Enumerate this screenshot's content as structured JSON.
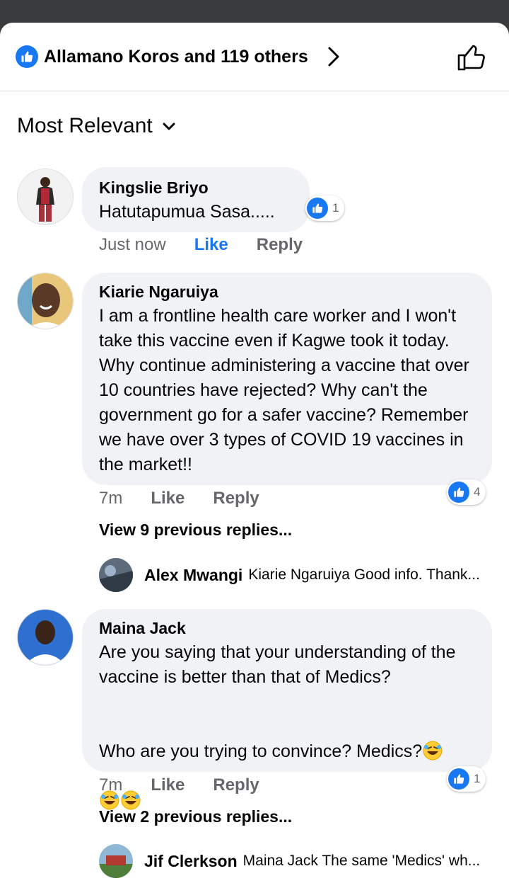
{
  "reactions": {
    "summary": "Allamano Koros and 119 others",
    "icon": "like-badge-icon"
  },
  "sort": {
    "label": "Most Relevant"
  },
  "comments": [
    {
      "author": "Kingslie Briyo",
      "text": "Hatutapumua Sasa.....",
      "time": "Just now",
      "like_label": "Like",
      "reply_label": "Reply",
      "like_count": "1",
      "liked": true
    },
    {
      "author": "Kiarie Ngaruiya",
      "text": "I am a frontline health care worker and I won't take this vaccine even if Kagwe took it today. Why continue administering a vaccine that over 10 countries have rejected? Why can't the government go for a safer vaccine? Remember we have over 3 types of COVID 19 vaccines in the market!!",
      "time": "7m",
      "like_label": "Like",
      "reply_label": "Reply",
      "like_count": "4",
      "view_replies": "View 9 previous replies...",
      "latest_reply": {
        "author": "Alex Mwangi",
        "text": "Kiarie Ngaruiya Good info. Thank..."
      }
    },
    {
      "author": "Maina Jack",
      "text_line1": "Are you saying that your understanding of the vaccine is better than that of Medics?",
      "text_line2": "Who are you trying to convince? Medics?",
      "emoji": "rolling-on-floor-laughing-emoji",
      "time": "7m",
      "like_label": "Like",
      "reply_label": "Reply",
      "like_count": "1",
      "view_replies": "View 2 previous replies...",
      "latest_reply": {
        "author": "Jif Clerkson",
        "text": "Maina Jack The same 'Medics' wh..."
      }
    }
  ],
  "colors": {
    "accent": "#1877f2",
    "bubble": "#f0f2f5",
    "muted": "#65676b"
  }
}
